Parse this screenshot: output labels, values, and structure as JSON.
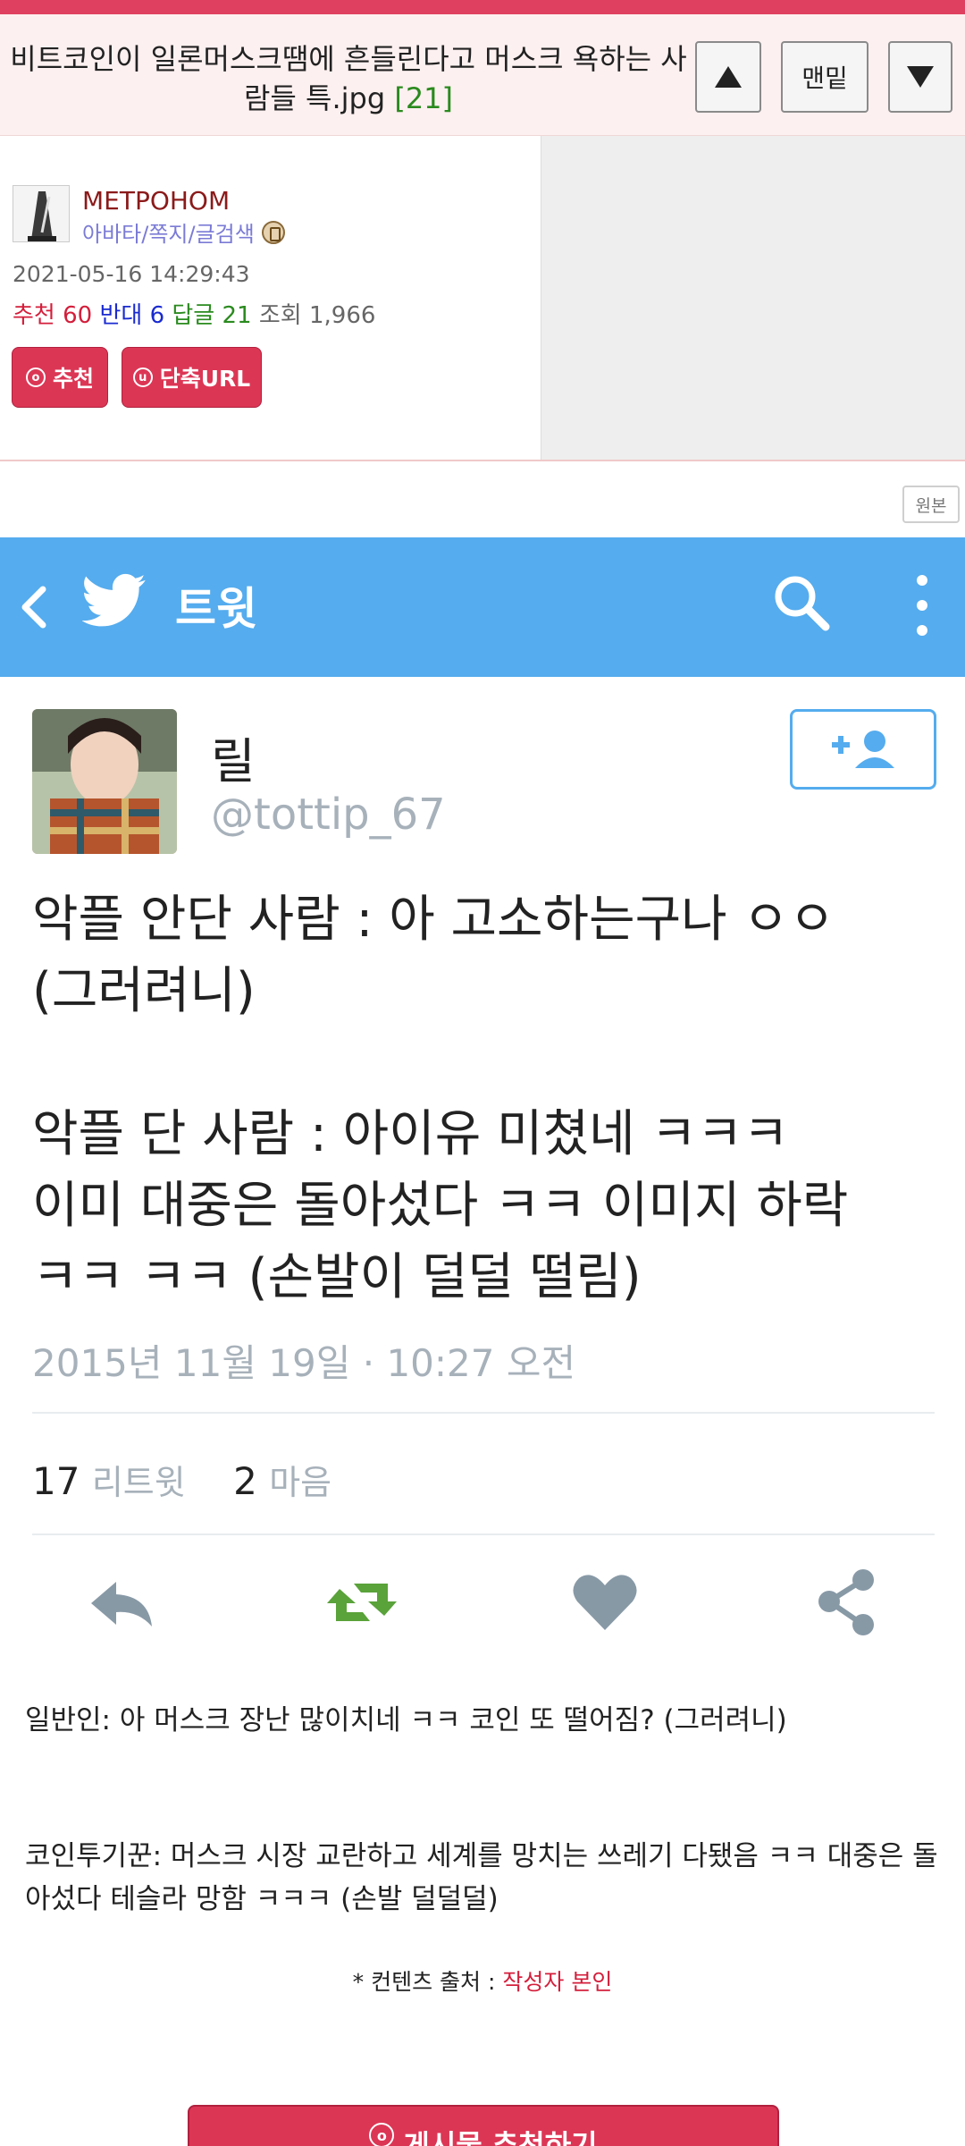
{
  "header": {
    "title": "비트코인이 일론머스크땜에 흔들린다고 머스크 욕하는 사람들 특.jpg",
    "comment_count": "[21]",
    "up_button": "▲",
    "bottom_button": "맨밑",
    "down_button": "▼"
  },
  "post_info": {
    "author": "METPOHOM",
    "author_links": "아바타/쪽지/글검색",
    "date": "2021-05-16 14:29:43",
    "recommend_label": "추천",
    "recommend_value": "60",
    "oppose_label": "반대",
    "oppose_value": "6",
    "reply_label": "답글",
    "reply_value": "21",
    "view_label": "조회",
    "view_value": "1,966",
    "recommend_button": "추천",
    "short_url_button": "단축URL"
  },
  "original_button": "원본",
  "tweet": {
    "header_title": "트윗",
    "name": "릴",
    "handle": "@tottip_67",
    "text": "악플 안단 사람 : 아 고소하는구나 ㅇㅇ\n(그러려니)\n\n악플 단 사람 : 아이유 미쳤네 ㅋㅋㅋ\n이미 대중은 돌아섰다 ㅋㅋ 이미지 하락\nㅋㅋ ㅋㅋ (손발이 덜덜 떨림)",
    "timestamp": "2015년 11월 19일 · 10:27 오전",
    "retweets_count": "17",
    "retweets_label": "리트윗",
    "likes_count": "2",
    "likes_label": "마음"
  },
  "post_body": {
    "paragraph1": "일반인: 아 머스크 장난 많이치네 ㅋㅋ 코인 또 떨어짐? (그러려니)",
    "paragraph2": "코인투기꾼: 머스크 시장 교란하고 세계를 망치는 쓰레기 다됐음 ㅋㅋ 대중은 돌아섰다 테슬라 망함 ㅋㅋㅋ  (손발 덜덜덜)",
    "source_label": "* 컨텐츠 출처 : ",
    "source_value": "작성자 본인"
  },
  "bottom_button": "게시물 추천하기",
  "colors": {
    "accent": "#dc3655",
    "twitter_blue": "#55acee",
    "retweet_green": "#5aa23a",
    "gray_icon": "#8899a6"
  }
}
